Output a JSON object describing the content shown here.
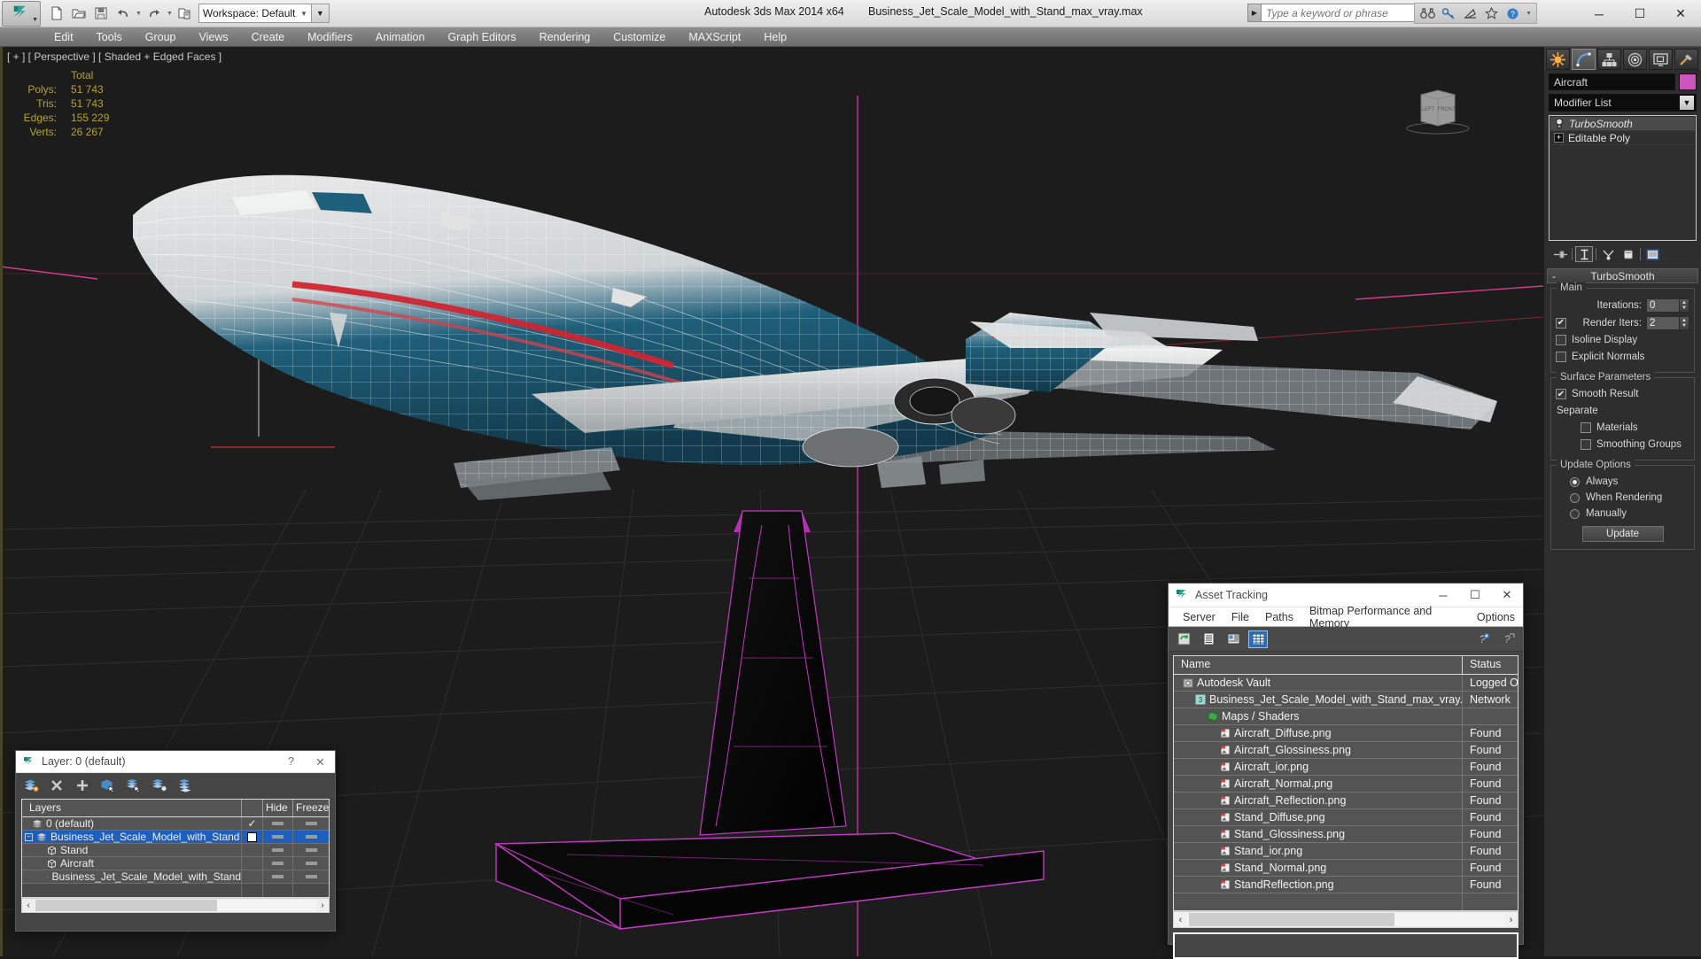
{
  "titlebar": {
    "app_title": "Autodesk 3ds Max  2014 x64",
    "file_name": "Business_Jet_Scale_Model_with_Stand_max_vray.max",
    "workspace_label": "Workspace: Default",
    "search_placeholder": "Type a keyword or phrase",
    "quick_access": [
      {
        "name": "new-file-icon",
        "label": "New"
      },
      {
        "name": "open-file-icon",
        "label": "Open"
      },
      {
        "name": "save-file-icon",
        "label": "Save"
      },
      {
        "name": "undo-icon",
        "label": "Undo"
      },
      {
        "name": "redo-icon",
        "label": "Redo"
      },
      {
        "name": "project-folder-icon",
        "label": "Set Project Folder"
      }
    ],
    "help_icons": [
      {
        "name": "binoculars-icon"
      },
      {
        "name": "key-icon"
      },
      {
        "name": "satellite-dish-icon"
      },
      {
        "name": "star-icon"
      },
      {
        "name": "help-circle-icon"
      }
    ],
    "window_controls": {
      "minimize": "─",
      "maximize": "☐",
      "close": "✕"
    }
  },
  "menubar": {
    "items": [
      "Edit",
      "Tools",
      "Group",
      "Views",
      "Create",
      "Modifiers",
      "Animation",
      "Graph Editors",
      "Rendering",
      "Customize",
      "MAXScript",
      "Help"
    ]
  },
  "viewport": {
    "label": "[ + ] [ Perspective ] [ Shaded + Edged Faces ]",
    "stats": {
      "header": "Total",
      "rows": [
        {
          "label": "Polys:",
          "value": "51 743"
        },
        {
          "label": "Tris:",
          "value": "51 743"
        },
        {
          "label": "Edges:",
          "value": "155 229"
        },
        {
          "label": "Verts:",
          "value": "26 267"
        }
      ]
    },
    "viewcube_faces": [
      "LEFT",
      "FRONT"
    ]
  },
  "command_panel": {
    "tabs": [
      {
        "name": "tab-create",
        "label": "Create"
      },
      {
        "name": "tab-modify",
        "label": "Modify"
      },
      {
        "name": "tab-hierarchy",
        "label": "Hierarchy"
      },
      {
        "name": "tab-motion",
        "label": "Motion"
      },
      {
        "name": "tab-display",
        "label": "Display"
      },
      {
        "name": "tab-utilities",
        "label": "Utilities"
      }
    ],
    "active_tab": 1,
    "object_name": "Aircraft",
    "object_color": "#cc55bb",
    "modifier_list_label": "Modifier List",
    "stack": [
      {
        "label": "TurboSmooth",
        "selected": true
      },
      {
        "label": "Editable Poly",
        "selected": false
      }
    ],
    "rollout": {
      "title": "TurboSmooth",
      "collapse_glyph": "-",
      "groups": {
        "main": {
          "label": "Main",
          "iterations_label": "Iterations:",
          "iterations_value": "0",
          "render_iters_label": "Render Iters:",
          "render_iters_value": "2",
          "render_iters_checked": true,
          "isoline_display_label": "Isoline Display",
          "isoline_display_checked": false,
          "explicit_normals_label": "Explicit Normals",
          "explicit_normals_checked": false
        },
        "surface": {
          "label": "Surface Parameters",
          "smooth_result_label": "Smooth Result",
          "smooth_result_checked": true,
          "separate_label": "Separate",
          "materials_label": "Materials",
          "materials_checked": false,
          "smoothing_groups_label": "Smoothing Groups",
          "smoothing_groups_checked": false
        },
        "update": {
          "label": "Update Options",
          "options": [
            {
              "label": "Always",
              "selected": true
            },
            {
              "label": "When Rendering",
              "selected": false
            },
            {
              "label": "Manually",
              "selected": false
            }
          ],
          "update_button": "Update"
        }
      }
    }
  },
  "asset_tracking": {
    "title": "Asset Tracking",
    "window_controls": {
      "minimize": "─",
      "maximize": "☐",
      "close": "✕"
    },
    "menu": [
      "Server",
      "File",
      "Paths",
      "Bitmap Performance and Memory",
      "Options"
    ],
    "toolbar": [
      {
        "name": "refresh-icon",
        "active": false
      },
      {
        "name": "list-view-icon",
        "active": false
      },
      {
        "name": "thumbnail-view-icon",
        "active": false
      },
      {
        "name": "grid-view-icon",
        "active": true
      },
      {
        "name": "add-help-icon",
        "active": false
      },
      {
        "name": "query-help-icon",
        "active": false
      }
    ],
    "columns": [
      "Name",
      "Status"
    ],
    "rows": [
      {
        "name": "Autodesk Vault",
        "status": "Logged O",
        "indent": 0,
        "icon": "vault-icon"
      },
      {
        "name": "Business_Jet_Scale_Model_with_Stand_max_vray.max",
        "status": "Network",
        "indent": 1,
        "icon": "max-file-icon"
      },
      {
        "name": "Maps / Shaders",
        "status": "",
        "indent": 2,
        "icon": "maps-icon"
      },
      {
        "name": "Aircraft_Diffuse.png",
        "status": "Found",
        "indent": 3,
        "icon": "png-icon"
      },
      {
        "name": "Aircraft_Glossiness.png",
        "status": "Found",
        "indent": 3,
        "icon": "png-icon"
      },
      {
        "name": "Aircraft_ior.png",
        "status": "Found",
        "indent": 3,
        "icon": "png-icon"
      },
      {
        "name": "Aircraft_Normal.png",
        "status": "Found",
        "indent": 3,
        "icon": "png-icon"
      },
      {
        "name": "Aircraft_Reflection.png",
        "status": "Found",
        "indent": 3,
        "icon": "png-icon"
      },
      {
        "name": "Stand_Diffuse.png",
        "status": "Found",
        "indent": 3,
        "icon": "png-icon"
      },
      {
        "name": "Stand_Glossiness.png",
        "status": "Found",
        "indent": 3,
        "icon": "png-icon"
      },
      {
        "name": "Stand_ior.png",
        "status": "Found",
        "indent": 3,
        "icon": "png-icon"
      },
      {
        "name": "Stand_Normal.png",
        "status": "Found",
        "indent": 3,
        "icon": "png-icon"
      },
      {
        "name": "StandReflection.png",
        "status": "Found",
        "indent": 3,
        "icon": "png-icon"
      }
    ],
    "scroll_left": "‹",
    "scroll_right": "›"
  },
  "layer_dialog": {
    "title": "Layer: 0 (default)",
    "help_glyph": "?",
    "close_glyph": "✕",
    "toolbar": [
      {
        "name": "create-new-layer-icon"
      },
      {
        "name": "delete-layer-icon"
      },
      {
        "name": "add-selection-to-layer-icon"
      },
      {
        "name": "select-objects-in-layer-icon"
      },
      {
        "name": "select-highlighted-layers-icon"
      },
      {
        "name": "highlight-selected-objects-layer-icon"
      },
      {
        "name": "set-current-layer-icon"
      }
    ],
    "columns": [
      "Layers",
      "Hide",
      "Freeze"
    ],
    "rows": [
      {
        "name": "0 (default)",
        "indent": 0,
        "current": true,
        "selected": false,
        "icon": "layer-icon",
        "expand": false
      },
      {
        "name": "Business_Jet_Scale_Model_with_Stand",
        "indent": 0,
        "current": false,
        "selected": true,
        "icon": "layer-icon",
        "expand": true
      },
      {
        "name": "Stand",
        "indent": 1,
        "current": false,
        "selected": false,
        "icon": "object-icon",
        "expand": false
      },
      {
        "name": "Aircraft",
        "indent": 1,
        "current": false,
        "selected": false,
        "icon": "object-icon",
        "expand": false
      },
      {
        "name": "Business_Jet_Scale_Model_with_Stand",
        "indent": 1,
        "current": false,
        "selected": false,
        "icon": "object-icon",
        "expand": false
      }
    ],
    "scroll_left": "‹",
    "scroll_right": "›"
  }
}
